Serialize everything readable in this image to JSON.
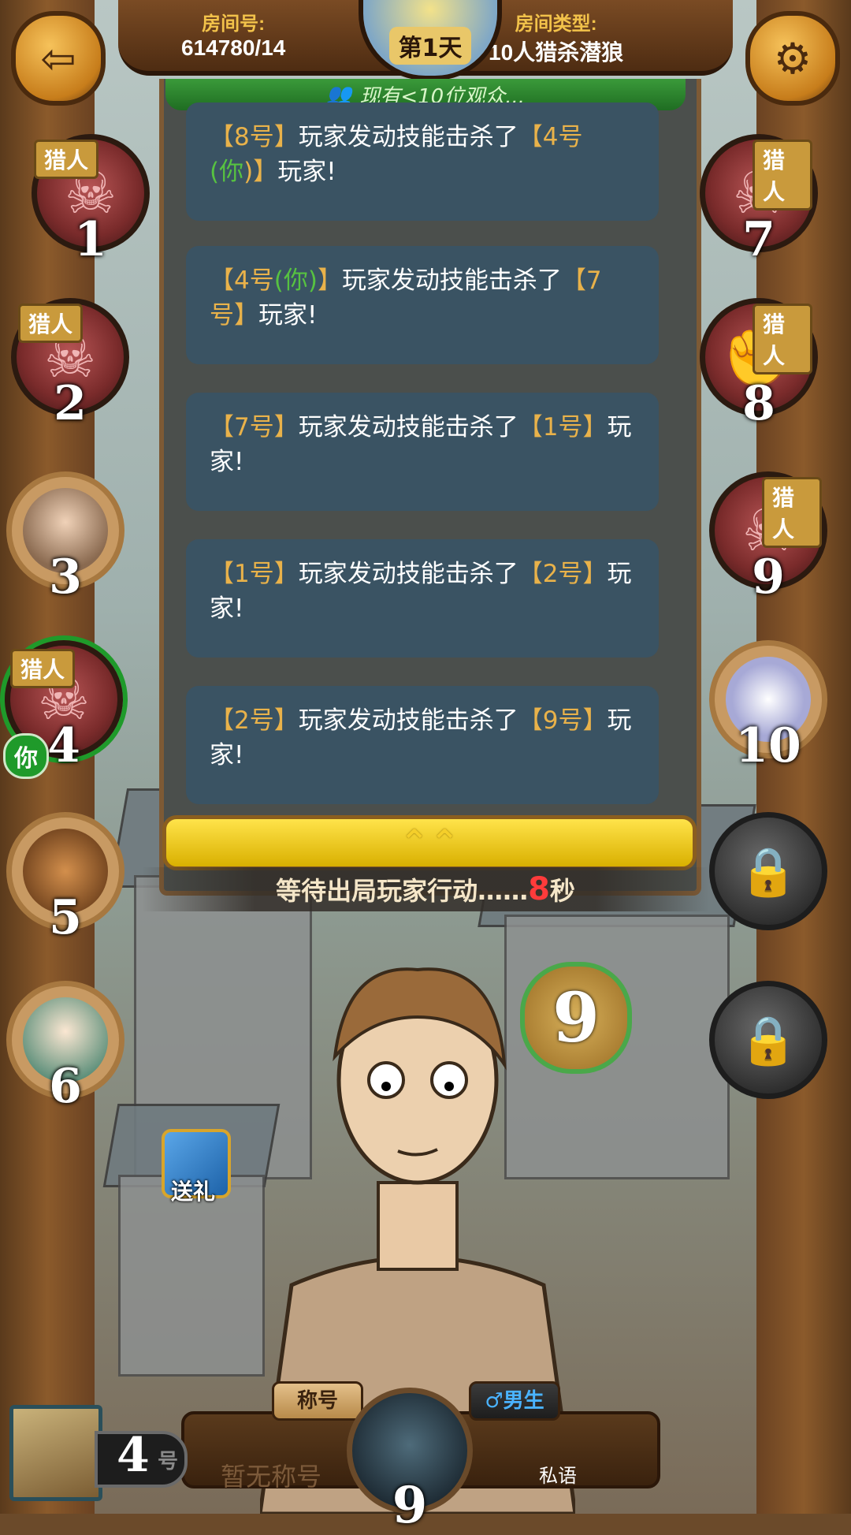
{
  "header": {
    "room_id_label": "房间号:",
    "room_id": "614780/14",
    "room_type_label": "房间类型:",
    "room_type": "10人猎杀潜狼",
    "day": "第1天",
    "back_icon": "back-arrow-icon",
    "settings_icon": "gear-icon"
  },
  "spectators": {
    "text": "现有<10位观众...",
    "icon": "people-icon"
  },
  "messages": [
    {
      "actor": "【8号】",
      "mid": "玩家发动技能击杀了",
      "target_num": "【4号",
      "target_you": "(你",
      "target_end": ")】",
      "tail": "玩家!"
    },
    {
      "actor_num": "【4号",
      "actor_you": "(你)",
      "actor_end": "】",
      "mid": "玩家发动技能击杀了",
      "target": "【7号】",
      "tail": "玩家!"
    },
    {
      "actor": "【7号】",
      "mid": "玩家发动技能击杀了",
      "target": "【1号】",
      "tail": "玩家!"
    },
    {
      "actor": "【1号】",
      "mid": "玩家发动技能击杀了",
      "target": "【2号】",
      "tail": "玩家!"
    },
    {
      "actor": "【2号】",
      "mid": "玩家发动技能击杀了",
      "target": "【9号】",
      "tail": "玩家!"
    }
  ],
  "expand_icon": "double-chevron-up-icon",
  "status": {
    "text": "等待出局玩家行动……",
    "seconds": "8",
    "unit": "秒"
  },
  "players": [
    {
      "num": "1",
      "dead": true,
      "tag": "猎人"
    },
    {
      "num": "2",
      "dead": true,
      "tag": "猎人"
    },
    {
      "num": "3",
      "dead": false,
      "tag": ""
    },
    {
      "num": "4",
      "dead": true,
      "tag": "猎人",
      "you": "你"
    },
    {
      "num": "5",
      "dead": false,
      "tag": ""
    },
    {
      "num": "6",
      "dead": false,
      "tag": ""
    },
    {
      "num": "7",
      "dead": true,
      "tag": "猎人"
    },
    {
      "num": "8",
      "dead": true,
      "tag": "猎人"
    },
    {
      "num": "9",
      "dead": true,
      "tag": "猎人"
    },
    {
      "num": "10",
      "dead": false,
      "tag": ""
    }
  ],
  "locked_seats": [
    "lock-icon",
    "lock-icon"
  ],
  "speech_num": "9",
  "gift": {
    "label": "送礼",
    "icon": "gift-box-icon"
  },
  "bottom": {
    "title_label": "称号",
    "gender": "♂男生",
    "no_title": "暂无称号",
    "whisper": "私语",
    "self_num": "9",
    "role_num": "4",
    "role_suffix": "号"
  },
  "colors": {
    "accent_gold": "#e9b24a",
    "accent_green": "#57c241",
    "countdown_red": "#ff3b3b"
  }
}
